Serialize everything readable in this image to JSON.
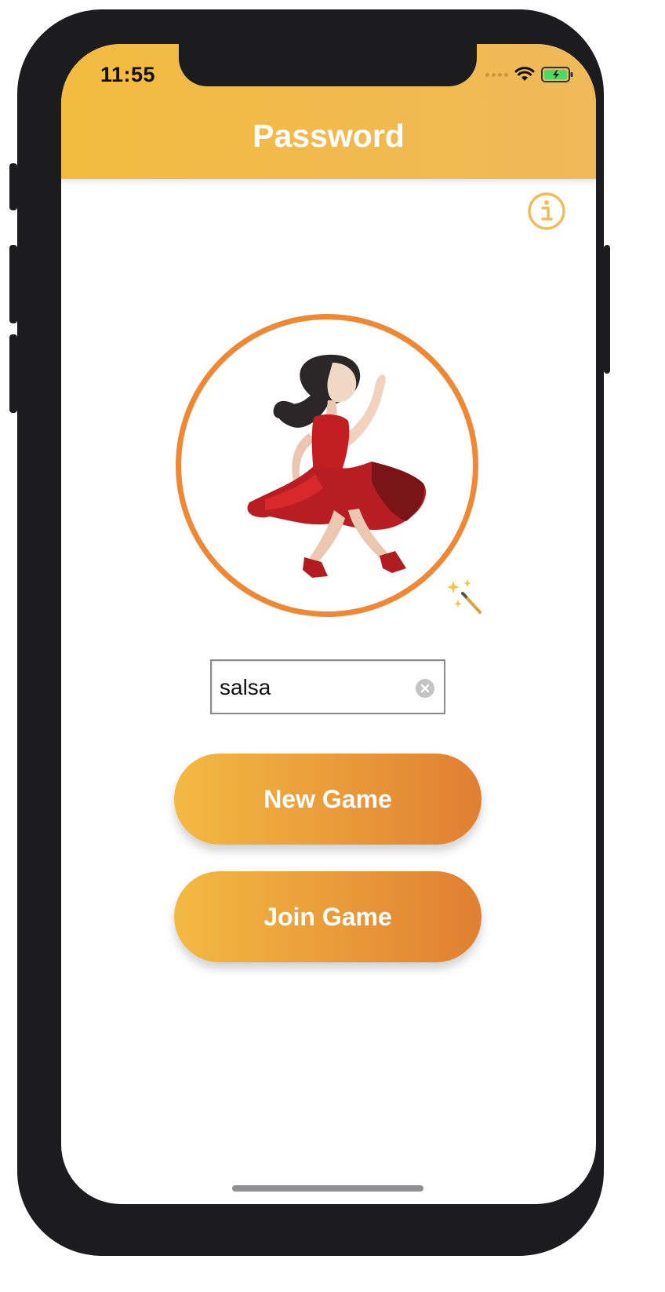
{
  "status_bar": {
    "time": "11:55"
  },
  "nav": {
    "title": "Password"
  },
  "password_field": {
    "value": "salsa"
  },
  "buttons": {
    "new_game": "New Game",
    "join_game": "Join Game"
  },
  "icons": {
    "info": "info-circle-icon",
    "avatar": "dancer-emoji-icon",
    "randomize": "magic-wand-icon",
    "clear": "clear-circle-icon"
  },
  "colors": {
    "header_gradient": [
      "#f3bb3f",
      "#f0b95a"
    ],
    "button_gradient": [
      "#f3ba42",
      "#e07f32"
    ],
    "ring": "#ef8733",
    "info": "#f1bd5c"
  }
}
